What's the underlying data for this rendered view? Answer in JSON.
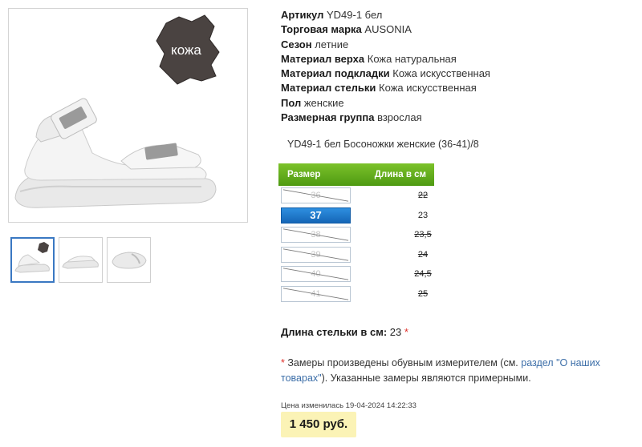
{
  "badge": {
    "text": "кожа"
  },
  "attributes": [
    {
      "name": "Артикул",
      "value": "YD49-1 бел"
    },
    {
      "name": "Торговая марка",
      "value": "AUSONIA"
    },
    {
      "name": "Сезон",
      "value": "летние"
    },
    {
      "name": "Материал верха",
      "value": "Кожа натуральная"
    },
    {
      "name": "Материал подкладки",
      "value": "Кожа искусственная"
    },
    {
      "name": "Материал стельки",
      "value": "Кожа искусственная"
    },
    {
      "name": "Пол",
      "value": "женские"
    },
    {
      "name": "Размерная группа",
      "value": "взрослая"
    }
  ],
  "product_name": "YD49-1 бел Босоножки женские (36-41)/8",
  "size_table": {
    "header_size": "Размер",
    "header_length": "Длина в см",
    "rows": [
      {
        "size": "36",
        "length": "22",
        "available": false
      },
      {
        "size": "37",
        "length": "23",
        "available": true
      },
      {
        "size": "38",
        "length": "23,5",
        "available": false
      },
      {
        "size": "39",
        "length": "24",
        "available": false
      },
      {
        "size": "40",
        "length": "24,5",
        "available": false
      },
      {
        "size": "41",
        "length": "25",
        "available": false
      }
    ]
  },
  "insole": {
    "label": "Длина стельки в см:",
    "value": "23",
    "star": "*"
  },
  "note": {
    "star": "*",
    "text_before": " Замеры произведены обувным измерителем (см. ",
    "link": "раздел \"О наших товарах\"",
    "text_after": "). Указанные замеры являются примерными."
  },
  "price_change": "Цена изменилась 19-04-2024 14:22:33",
  "price": "1 450 руб.",
  "colors": {
    "accent_green": "#5aa617",
    "selected_blue": "#1e7ad0",
    "price_bg": "#fbf3b6",
    "star_red": "#e0302a"
  }
}
